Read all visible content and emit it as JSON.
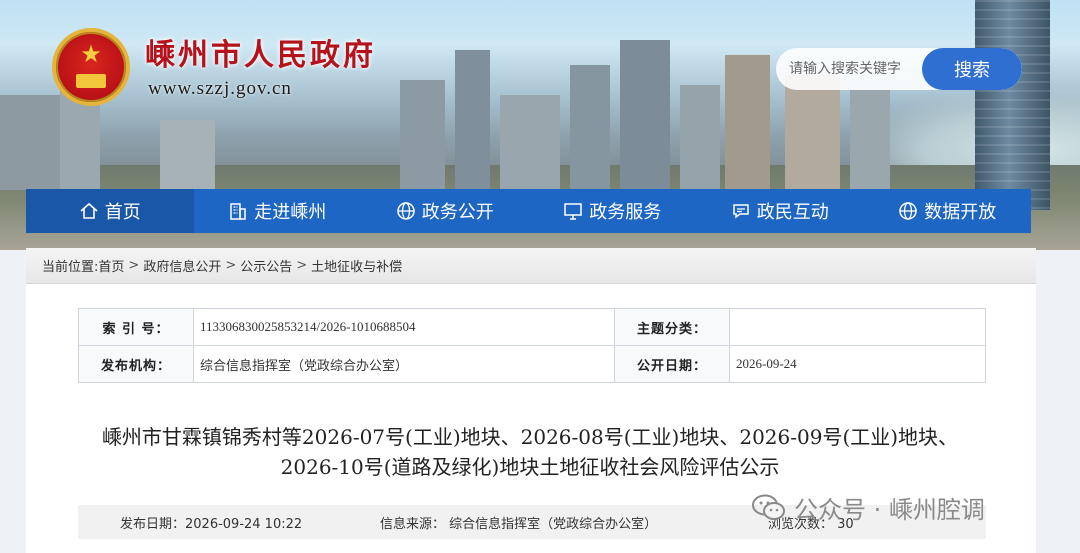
{
  "header": {
    "site_title": "嵊州市人民政府",
    "site_url": "www.szzj.gov.cn"
  },
  "search": {
    "placeholder": "请输入搜索关键字",
    "button_label": "搜索"
  },
  "nav": {
    "items": [
      {
        "label": "首页",
        "icon": "home-icon"
      },
      {
        "label": "走进嵊州",
        "icon": "building-icon"
      },
      {
        "label": "政务公开",
        "icon": "globe-icon"
      },
      {
        "label": "政务服务",
        "icon": "monitor-icon"
      },
      {
        "label": "政民互动",
        "icon": "chat-icon"
      },
      {
        "label": "数据开放",
        "icon": "globe-icon"
      }
    ]
  },
  "breadcrumb": {
    "prefix": "当前位置:",
    "items": [
      "首页",
      "政府信息公开",
      "公示公告",
      "土地征收与补偿"
    ],
    "separator": ">"
  },
  "meta": {
    "index_label": "索 引 号：",
    "index_value": "113306830025853214/2026-1010688504",
    "topic_label": "主题分类：",
    "topic_value": "",
    "publisher_label": "发布机构：",
    "publisher_value": "综合信息指挥室（党政综合办公室）",
    "date_label": "公开日期：",
    "date_value": "2026-09-24"
  },
  "article": {
    "title_line1": "嵊州市甘霖镇锦秀村等2026-07号(工业)地块、2026-08号(工业)地块、2026-09号(工业)地块、",
    "title_line2": "2026-10号(道路及绿化)地块土地征收社会风险评估公示"
  },
  "info_bar": {
    "publish_time": "发布日期：2026-09-24 10:22",
    "source": "信息来源：  综合信息指挥室（党政综合办公室）",
    "views": "浏览次数：  30"
  },
  "watermark": {
    "text": "公众号 · 嵊州腔调"
  },
  "colors": {
    "nav_blue": "#1e66c4",
    "title_red": "#b5121b",
    "search_button": "#2f6fd1"
  }
}
